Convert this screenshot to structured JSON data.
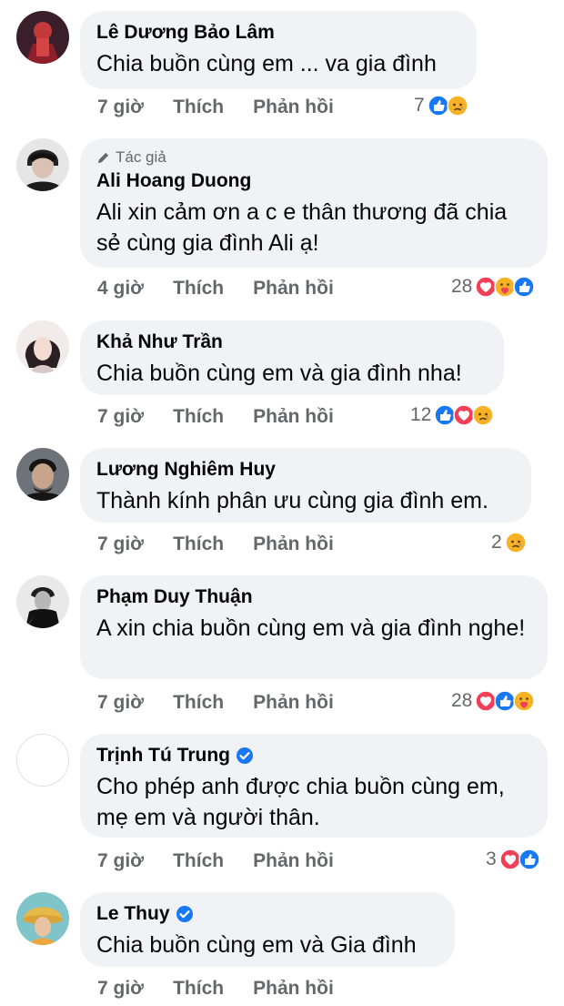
{
  "comments": [
    {
      "name": "Lê Dương Bảo Lâm",
      "text": "Chia buồn cùng em ... va gia đình",
      "time": "7 giờ",
      "like": "Thích",
      "reply": "Phản hồi",
      "count": "7",
      "reactions": [
        "like-icon",
        "sad-icon"
      ]
    },
    {
      "badge": "Tác giả",
      "name": "Ali Hoang Duong",
      "text": "Ali xin cảm ơn a c e thân thương đã chia sẻ cùng gia đình Ali ạ!",
      "time": "4 giờ",
      "like": "Thích",
      "reply": "Phản hồi",
      "count": "28",
      "reactions": [
        "love-icon",
        "care-icon",
        "like-icon"
      ]
    },
    {
      "name": "Khả Như Trần",
      "text": "Chia buồn cùng em và gia đình nha!",
      "time": "7 giờ",
      "like": "Thích",
      "reply": "Phản hồi",
      "count": "12",
      "reactions": [
        "like-icon",
        "love-icon",
        "sad-icon"
      ]
    },
    {
      "name": "Lương Nghiêm Huy",
      "text": "Thành kính phân ưu cùng gia đình em.",
      "time": "7 giờ",
      "like": "Thích",
      "reply": "Phản hồi",
      "count": "2",
      "reactions": [
        "sad-icon"
      ]
    },
    {
      "name": "Phạm Duy Thuận",
      "text": "A xin chia buồn cùng em và gia đình nghe!",
      "time": "7 giờ",
      "like": "Thích",
      "reply": "Phản hồi",
      "count": "28",
      "reactions": [
        "love-icon",
        "like-icon",
        "care-icon"
      ]
    },
    {
      "name": "Trịnh Tú Trung",
      "verified": true,
      "text": "Cho phép anh được chia buồn cùng em, mẹ em và người thân.",
      "time": "7 giờ",
      "like": "Thích",
      "reply": "Phản hồi",
      "count": "3",
      "reactions": [
        "love-icon",
        "like-icon"
      ]
    },
    {
      "name": "Le Thuy",
      "verified": true,
      "text": "Chia buồn cùng em và Gia đình",
      "time": "7 giờ",
      "like": "Thích",
      "reply": "Phản hồi",
      "count": "",
      "reactions": []
    }
  ],
  "colors": {
    "like": "#1877f2",
    "love": "#f33e58",
    "sad": "#f7b125",
    "secondary": "#65676b",
    "bubble": "#f0f2f5"
  }
}
